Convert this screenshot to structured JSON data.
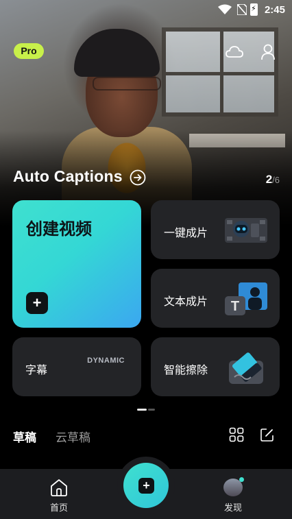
{
  "status_bar": {
    "time": "2:45"
  },
  "header": {
    "pro_label": "Pro"
  },
  "banner": {
    "title": "Auto Captions",
    "page_current": "2",
    "page_total": "/6"
  },
  "cards": {
    "create_video": "创建视频",
    "one_click": "一键成片",
    "text_to_video": "文本成片",
    "subtitles": "字幕",
    "subtitles_badge": "DYNAMIC",
    "smart_erase": "智能擦除"
  },
  "drafts": {
    "tab_drafts": "草稿",
    "tab_cloud": "云草稿"
  },
  "bottom_nav": {
    "home": "首页",
    "discover": "发现"
  },
  "colors": {
    "accent": "#3fe0cf",
    "pro": "#c8f04a",
    "card_bg": "#232427",
    "nav_bg": "#1c1d20"
  }
}
